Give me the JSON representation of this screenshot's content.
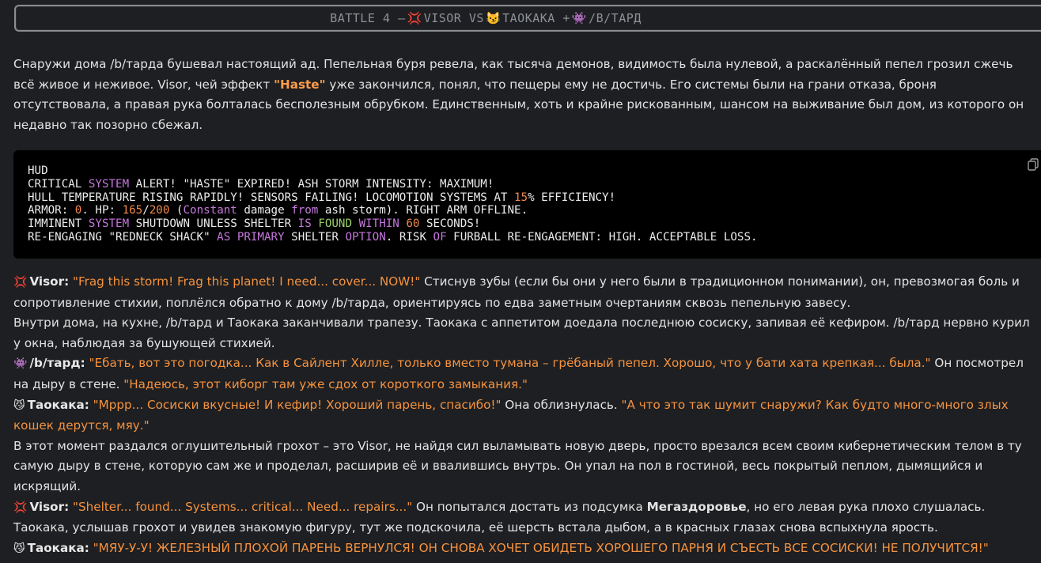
{
  "title": {
    "prefix": "BATTLE 4 – ",
    "emoji1": "💢",
    "name1": "VISOR VS ",
    "emoji2": "😼",
    "name2": "ТАОКАКА + ",
    "emoji3": "👾",
    "name3": "/B/ТАРД"
  },
  "intro": {
    "part1": "Снаружи дома /b/тарда бушевал настоящий ад. Пепельная буря ревела, как тысяча демонов, видимость была нулевой, а раскалённый пепел грозил сжечь всё живое и неживое. Visor, чей эффект ",
    "haste": "\"Haste\"",
    "part2": " уже закончился, понял, что пещеры ему не достичь. Его системы были на грани отказа, броня отсутствовала, а правая рука болталась бесполезным обрубком. Единственным, хоть и крайне рискованным, шансом на выживание был дом, из которого он недавно так позорно сбежал."
  },
  "hud": {
    "l1": "HUD",
    "l2a": "CRITICAL ",
    "l2b": "SYSTEM",
    "l2c": " ALERT! \"HASTE\" EXPIRED! ASH STORM INTENSITY: MAXIMUM!",
    "l3a": "HULL TEMPERATURE RISING RAPIDLY! SENSORS FAILING! LOCOMOTION SYSTEMS AT ",
    "l3b": "15",
    "l3c": "% EFFICIENCY!",
    "l4a": "ARMOR: ",
    "l4b": "0",
    "l4c": ". HP: ",
    "l4d": "165",
    "l4e": "/",
    "l4f": "200",
    "l4g": " (",
    "l4h": "Constant",
    "l4i": " damage ",
    "l4j": "from",
    "l4k": " ash storm). RIGHT ARM OFFLINE.",
    "l5a": "IMMINENT ",
    "l5b": "SYSTEM",
    "l5c": " SHUTDOWN UNLESS SHELTER ",
    "l5d": "IS",
    "l5e": " ",
    "l5f": "FOUND",
    "l5g": " ",
    "l5h": "WITHIN",
    "l5i": " ",
    "l5j": "60",
    "l5k": " SECONDS!",
    "l6a": "RE-ENGAGING \"REDNECK SHACK\" ",
    "l6b": "AS",
    "l6c": " ",
    "l6d": "PRIMARY",
    "l6e": " SHELTER ",
    "l6f": "OPTION",
    "l6g": ". RISK ",
    "l6h": "OF",
    "l6i": " FURBALL RE-ENGAGEMENT: HIGH. ACCEPTABLE LOSS."
  },
  "story": {
    "p1_emoji": "💢",
    "p1_speaker": "Visor:",
    "p1_quote": "\"Frag this storm! Frag this planet! I need... cover... NOW!\"",
    "p1_text": " Стиснув зубы (если бы они у него были в традиционном понимании), он, превозмогая боль и сопротивление стихии, поплёлся обратно к дому /b/тарда, ориентируясь по едва заметным очертаниям сквозь пепельную завесу.",
    "p2_text": "Внутри дома, на кухне, /b/тард и Таокака заканчивали трапезу. Таокака с аппетитом доедала последнюю сосиску, запивая её кефиром. /b/тард нервно курил у окна, наблюдая за бушующей стихией.",
    "p3_emoji": "👾",
    "p3_speaker": "/b/тард:",
    "p3_quote": "\"Ебать, вот это погодка... Как в Сайлент Хилле, только вместо тумана – грёбаный пепел. Хорошо, что у бати хата крепкая... была.\"",
    "p3_text": " Он посмотрел на дыру в стене. ",
    "p3_quote2": "\"Надеюсь, этот киборг там уже сдох от короткого замыкания.\"",
    "p4_emoji": "😼",
    "p4_speaker": "Таокака:",
    "p4_quote": "\"Мррр... Сосиски вкусные! И кефир! Хороший парень, спасибо!\"",
    "p4_text": " Она облизнулась. ",
    "p4_quote2": "\"А что это так шумит снаружи? Как будто много-много злых кошек дерутся, мяу.\"",
    "p5_text": "В этот момент раздался оглушительный грохот – это Visor, не найдя сил выламывать новую дверь, просто врезался всем своим кибернетическим телом в ту самую дыру в стене, которую сам же и проделал, расширив её и ввалившись внутрь. Он упал на пол в гостиной, весь покрытый пеплом, дымящийся и искрящий.",
    "p6_emoji": "💢",
    "p6_speaker": "Visor:",
    "p6_quote": "\"Shelter... found... Systems... critical... Need... repairs...\"",
    "p6_text": " Он попытался достать из подсумка ",
    "p6_bold": "Мегаздоровье",
    "p6_text2": ", но его левая рука плохо слушалась.",
    "p7_text": "Таокака, услышав грохот и увидев знакомую фигуру, тут же подскочила, её шерсть встала дыбом, а в красных глазах снова вспыхнула ярость.",
    "p8_emoji": "😼",
    "p8_speaker": "Таокака:",
    "p8_quote": "\"МЯУ-У-У! ЖЕЛЕЗНЫЙ ПЛОХОЙ ПАРЕНЬ ВЕРНУЛСЯ! ОН СНОВА ХОЧЕТ ОБИДЕТЬ ХОРОШЕГО ПАРНЯ И СЪЕСТЬ ВСЕ СОСИСКИ! НЕ ПОЛУЧИТСЯ!\""
  },
  "colors": {
    "accent_orange": "#f5923e",
    "code_keyword": "#c678dd",
    "code_number": "#f2894a",
    "code_string": "#9bcf6a"
  },
  "icons": {
    "copy": "copy-icon"
  }
}
